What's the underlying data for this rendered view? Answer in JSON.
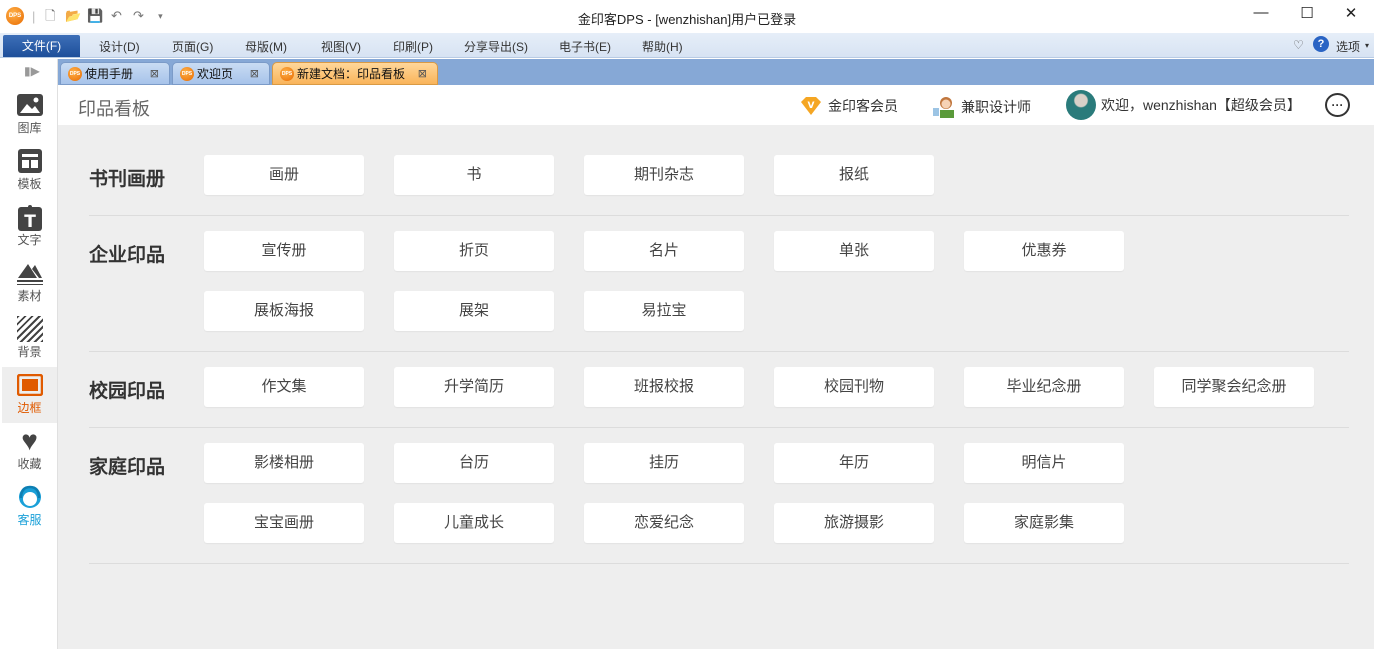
{
  "window": {
    "title": "金印客DPS - [wenzhishan]用户已登录",
    "logo": "DPS",
    "minimize": "—",
    "maximize": "☐",
    "close": "✕"
  },
  "menu": {
    "file": "文件(F)",
    "items": [
      "设计(D)",
      "页面(G)",
      "母版(M)",
      "视图(V)",
      "印刷(P)",
      "分享导出(S)",
      "电子书(E)",
      "帮助(H)"
    ],
    "options": "选项"
  },
  "tabs": [
    {
      "label": "使用手册"
    },
    {
      "label": "欢迎页"
    },
    {
      "label": "新建文档：印品看板",
      "active": true
    }
  ],
  "sidebar": {
    "items": [
      {
        "label": "图库",
        "icon": "image-icon"
      },
      {
        "label": "模板",
        "icon": "template-icon"
      },
      {
        "label": "文字",
        "icon": "text-icon"
      },
      {
        "label": "素材",
        "icon": "material-icon"
      },
      {
        "label": "背景",
        "icon": "background-icon"
      },
      {
        "label": "边框",
        "icon": "border-icon",
        "active": true
      },
      {
        "label": "收藏",
        "icon": "heart-icon"
      },
      {
        "label": "客服",
        "icon": "headset-icon"
      }
    ]
  },
  "header": {
    "title": "印品看板",
    "vip": "金印客会员",
    "designer": "兼职设计师",
    "welcome": "欢迎，wenzhishan【超级会员】"
  },
  "sections": [
    {
      "title": "书刊画册",
      "rows": [
        [
          "画册",
          "书",
          "期刊杂志",
          "报纸"
        ]
      ]
    },
    {
      "title": "企业印品",
      "rows": [
        [
          "宣传册",
          "折页",
          "名片",
          "单张",
          "优惠券"
        ],
        [
          "展板海报",
          "展架",
          "易拉宝"
        ]
      ]
    },
    {
      "title": "校园印品",
      "rows": [
        [
          "作文集",
          "升学简历",
          "班报校报",
          "校园刊物",
          "毕业纪念册",
          "同学聚会纪念册"
        ]
      ]
    },
    {
      "title": "家庭印品",
      "rows": [
        [
          "影楼相册",
          "台历",
          "挂历",
          "年历",
          "明信片"
        ],
        [
          "宝宝画册",
          "儿童成长",
          "恋爱纪念",
          "旅游摄影",
          "家庭影集"
        ]
      ]
    }
  ],
  "colors": {
    "accent": "#e05a00",
    "tab_active": "#f9b45a",
    "menu_file": "#1e4f9a",
    "service": "#1aa0d8"
  }
}
